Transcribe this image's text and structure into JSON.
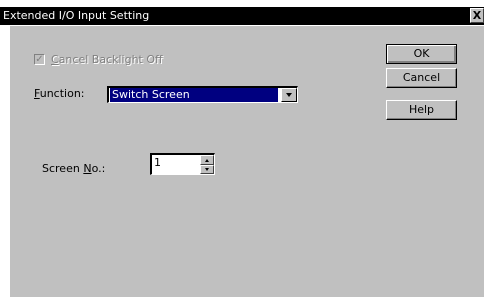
{
  "window": {
    "title": "Extended I/O Input Setting",
    "close_glyph": "X"
  },
  "options": {
    "cancel_backlight": {
      "label_prefix": "",
      "label_mnemonic": "C",
      "label_rest": "ancel Backlight Off",
      "checked": true,
      "enabled": false
    },
    "function": {
      "label_mnemonic": "F",
      "label_rest": "unction:",
      "selected": "Switch Screen"
    },
    "screen_no": {
      "label_prefix": "Screen ",
      "label_mnemonic": "N",
      "label_rest": "o.:",
      "value": "1"
    }
  },
  "buttons": {
    "ok": "OK",
    "cancel": "Cancel",
    "help": "Help"
  },
  "colors": {
    "titlebar": "#000000",
    "face": "#c0c0c0",
    "selection": "#000080"
  }
}
